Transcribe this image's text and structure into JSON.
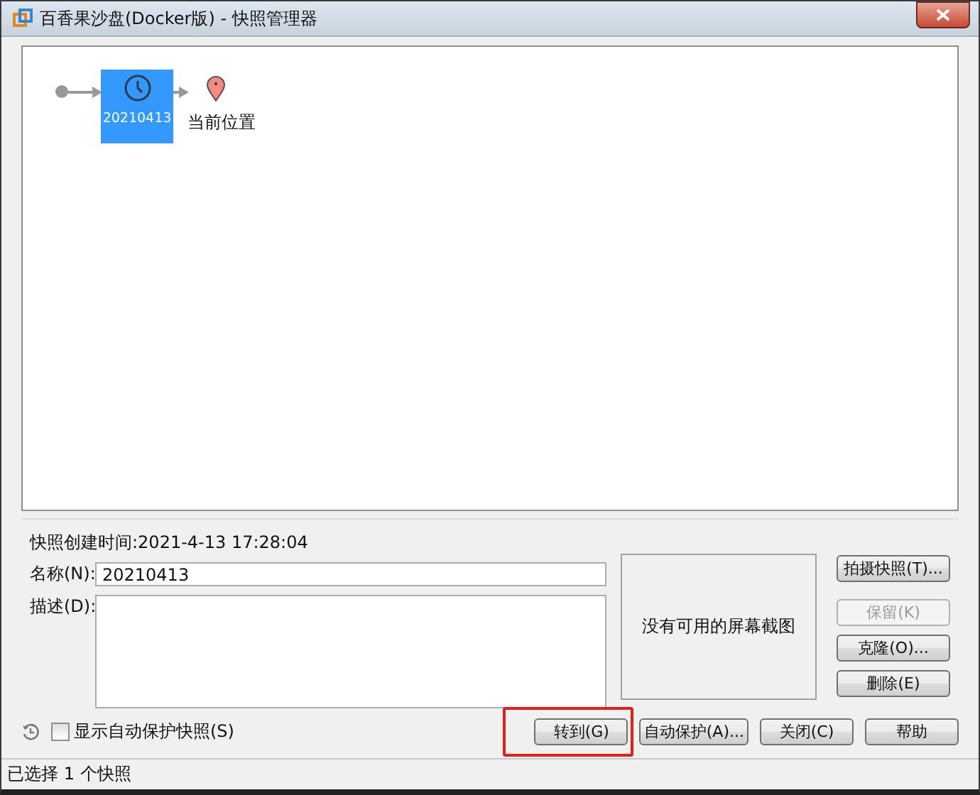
{
  "window": {
    "title": "百香果沙盘(Docker版) - 快照管理器"
  },
  "tree": {
    "snapshots": [
      {
        "label": "20210413",
        "selected": true
      }
    ],
    "current": {
      "label": "当前位置"
    }
  },
  "details": {
    "created": "快照创建时间:2021-4-13 17:28:04",
    "name_label": "名称(N):",
    "name_value": "20210413",
    "description_label": "描述(D):",
    "preview_text": "没有可用的屏幕截图"
  },
  "side_buttons": [
    {
      "label": "拍摄快照(T)...",
      "disabled": false
    },
    {
      "label": "保留(K)",
      "disabled": true
    },
    {
      "label": "克隆(O)...",
      "disabled": false
    },
    {
      "label": "删除(E)",
      "disabled": false
    }
  ],
  "show_autoprotect": {
    "label": "显示自动保护快照(S)",
    "checked": false
  },
  "bottom_buttons": [
    {
      "label": "转到(G)",
      "highlighted": true
    },
    {
      "label": "自动保护(A)...",
      "highlighted": false
    },
    {
      "label": "关闭(C)",
      "highlighted": false
    },
    {
      "label": "帮助",
      "highlighted": false
    }
  ],
  "status_bar": "已选择 1 个快照"
}
